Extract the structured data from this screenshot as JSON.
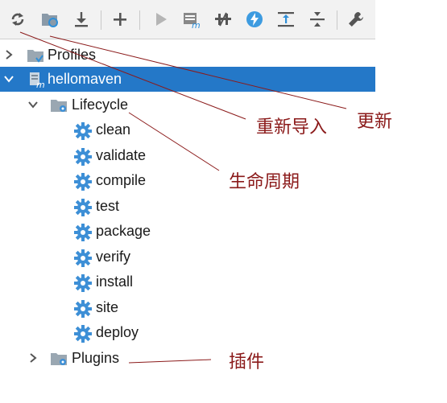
{
  "toolbar": {
    "icons": [
      "reimport-all-icon",
      "reimport-folder-icon",
      "download-icon",
      "add-icon",
      "run-icon",
      "execute-goal-icon",
      "toggle-offline-icon",
      "skip-tests-icon",
      "show-dependencies-icon",
      "collapse-all-icon",
      "settings-wrench-icon"
    ]
  },
  "tree": {
    "profiles": "Profiles",
    "project": "hellomaven",
    "lifecycle": "Lifecycle",
    "phases": [
      "clean",
      "validate",
      "compile",
      "test",
      "package",
      "verify",
      "install",
      "site",
      "deploy"
    ],
    "plugins": "Plugins"
  },
  "annotations": {
    "reimport": "重新导入",
    "update": "更新",
    "lifecycle": "生命周期",
    "plugins": "插件"
  },
  "colors": {
    "selection": "#2478c8",
    "annotation": "#8b1a1a",
    "gear": "#3d8fd6"
  }
}
